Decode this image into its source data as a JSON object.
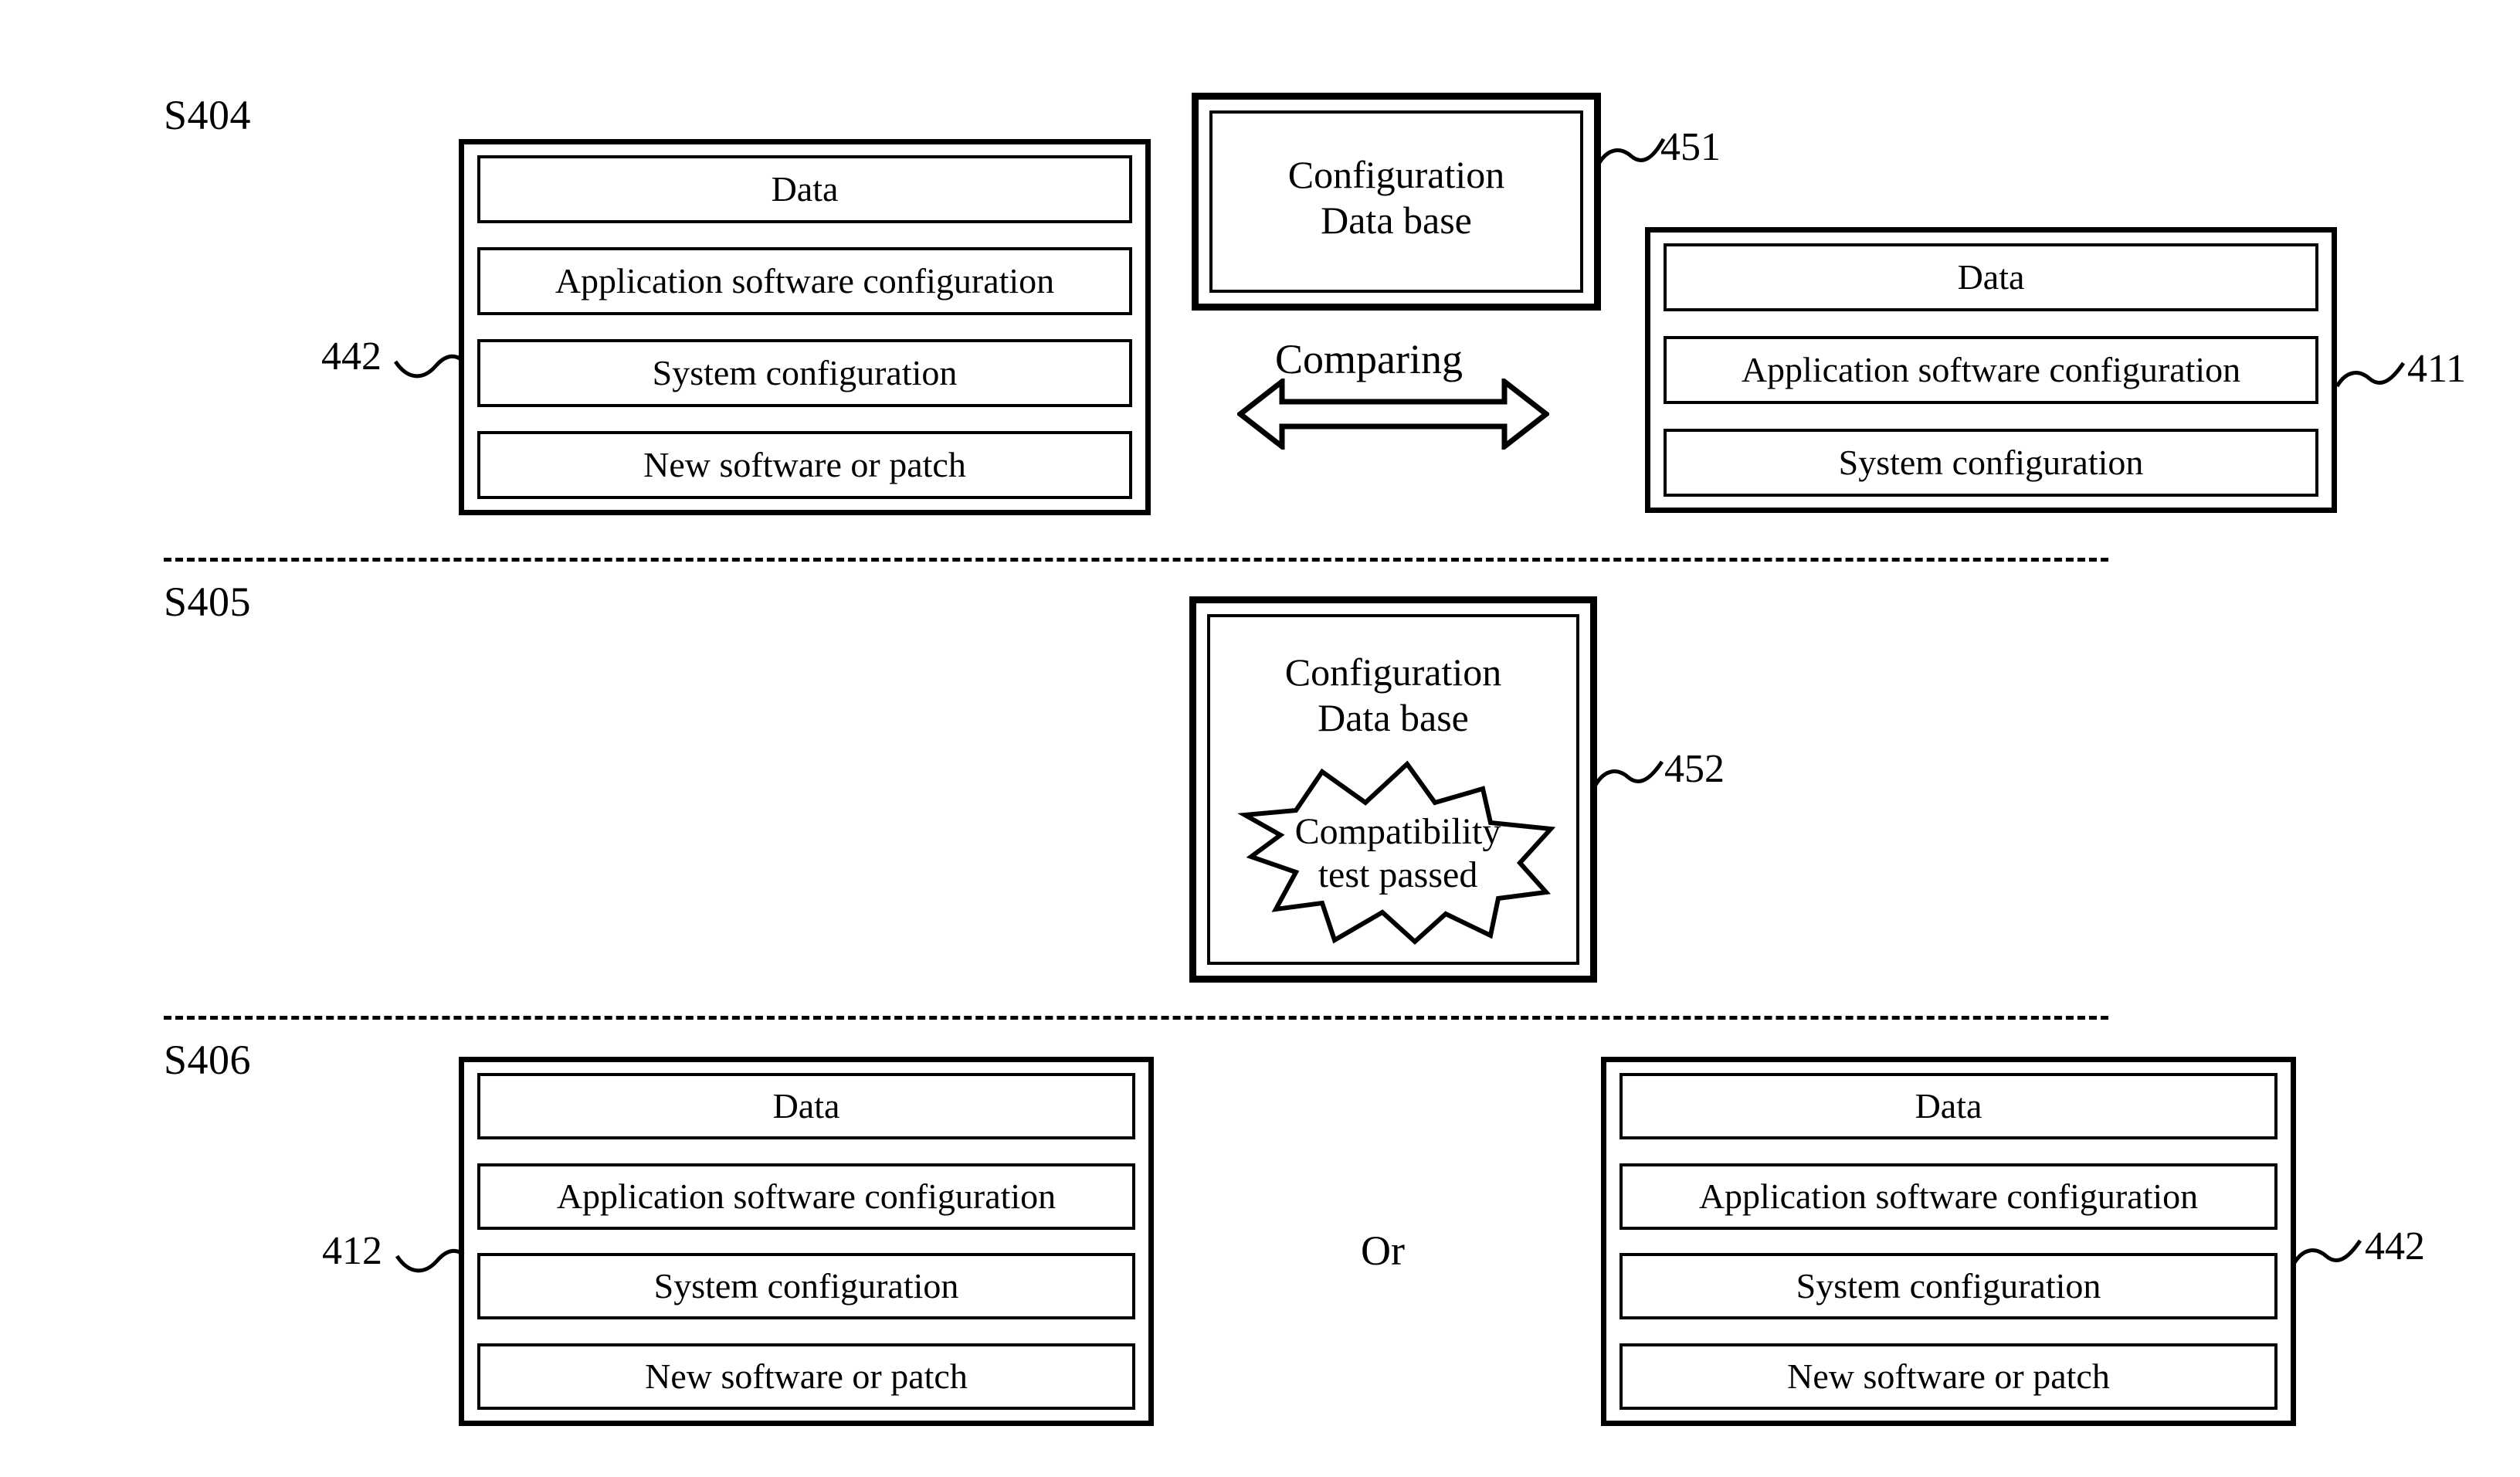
{
  "figure": {
    "kind": "patent-flow-diagram",
    "stroke_color": "#000000",
    "background_color": "#ffffff"
  },
  "sections": [
    {
      "id": "s404",
      "label": "S404"
    },
    {
      "id": "s405",
      "label": "S405"
    },
    {
      "id": "s406",
      "label": "S406"
    }
  ],
  "rows": {
    "data": "Data",
    "app_config": "Application software configuration",
    "sys_config": "System configuration",
    "new_software": "New software or patch"
  },
  "s404": {
    "left_stack": {
      "ref": "442",
      "rows": [
        "Data",
        "Application software configuration",
        "System configuration",
        "New software or patch"
      ]
    },
    "database": {
      "ref": "451",
      "title": "Configuration\nData base"
    },
    "comparing_label": "Comparing",
    "right_stack": {
      "ref": "411",
      "rows": [
        "Data",
        "Application software configuration",
        "System configuration"
      ]
    }
  },
  "s405": {
    "database": {
      "ref": "452",
      "title": "Configuration\nData base",
      "burst_text": "Compatibility\ntest passed"
    }
  },
  "s406": {
    "left_stack": {
      "ref": "412",
      "rows": [
        "Data",
        "Application software configuration",
        "System configuration",
        "New software or patch"
      ]
    },
    "or_label": "Or",
    "right_stack": {
      "ref": "442",
      "rows": [
        "Data",
        "Application software configuration",
        "System configuration",
        "New software or patch"
      ]
    }
  }
}
